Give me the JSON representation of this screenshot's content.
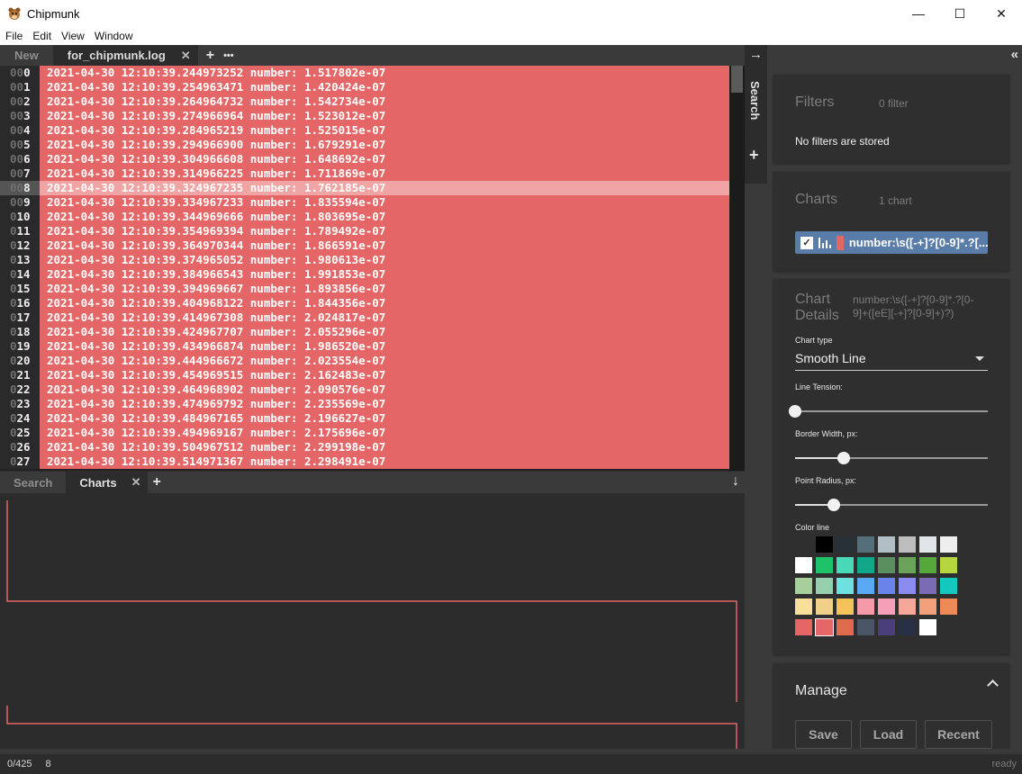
{
  "window": {
    "title": "Chipmunk",
    "minimize": "—",
    "maximize": "☐",
    "close": "✕"
  },
  "menu": [
    "File",
    "Edit",
    "View",
    "Window"
  ],
  "tabs": {
    "new_label": "New",
    "file_label": "for_chipmunk.log",
    "close": "✕",
    "add": "+",
    "more": "•••"
  },
  "log": {
    "rows": [
      {
        "n": "0",
        "pad": "00",
        "text": "2021-04-30 12:10:39.244973252 number: 1.517802e-07"
      },
      {
        "n": "1",
        "pad": "00",
        "text": "2021-04-30 12:10:39.254963471 number: 1.420424e-07"
      },
      {
        "n": "2",
        "pad": "00",
        "text": "2021-04-30 12:10:39.264964732 number: 1.542734e-07"
      },
      {
        "n": "3",
        "pad": "00",
        "text": "2021-04-30 12:10:39.274966964 number: 1.523012e-07"
      },
      {
        "n": "4",
        "pad": "00",
        "text": "2021-04-30 12:10:39.284965219 number: 1.525015e-07"
      },
      {
        "n": "5",
        "pad": "00",
        "text": "2021-04-30 12:10:39.294966900 number: 1.679291e-07"
      },
      {
        "n": "6",
        "pad": "00",
        "text": "2021-04-30 12:10:39.304966608 number: 1.648692e-07"
      },
      {
        "n": "7",
        "pad": "00",
        "text": "2021-04-30 12:10:39.314966225 number: 1.711869e-07"
      },
      {
        "n": "8",
        "pad": "00",
        "text": "2021-04-30 12:10:39.324967235 number: 1.762185e-07"
      },
      {
        "n": "9",
        "pad": "00",
        "text": "2021-04-30 12:10:39.334967233 number: 1.835594e-07"
      },
      {
        "n": "10",
        "pad": "0",
        "text": "2021-04-30 12:10:39.344969666 number: 1.803695e-07"
      },
      {
        "n": "11",
        "pad": "0",
        "text": "2021-04-30 12:10:39.354969394 number: 1.789492e-07"
      },
      {
        "n": "12",
        "pad": "0",
        "text": "2021-04-30 12:10:39.364970344 number: 1.866591e-07"
      },
      {
        "n": "13",
        "pad": "0",
        "text": "2021-04-30 12:10:39.374965052 number: 1.980613e-07"
      },
      {
        "n": "14",
        "pad": "0",
        "text": "2021-04-30 12:10:39.384966543 number: 1.991853e-07"
      },
      {
        "n": "15",
        "pad": "0",
        "text": "2021-04-30 12:10:39.394969667 number: 1.893856e-07"
      },
      {
        "n": "16",
        "pad": "0",
        "text": "2021-04-30 12:10:39.404968122 number: 1.844356e-07"
      },
      {
        "n": "17",
        "pad": "0",
        "text": "2021-04-30 12:10:39.414967308 number: 2.024817e-07"
      },
      {
        "n": "18",
        "pad": "0",
        "text": "2021-04-30 12:10:39.424967707 number: 2.055296e-07"
      },
      {
        "n": "19",
        "pad": "0",
        "text": "2021-04-30 12:10:39.434966874 number: 1.986520e-07"
      },
      {
        "n": "20",
        "pad": "0",
        "text": "2021-04-30 12:10:39.444966672 number: 2.023554e-07"
      },
      {
        "n": "21",
        "pad": "0",
        "text": "2021-04-30 12:10:39.454969515 number: 2.162483e-07"
      },
      {
        "n": "22",
        "pad": "0",
        "text": "2021-04-30 12:10:39.464968902 number: 2.090576e-07"
      },
      {
        "n": "23",
        "pad": "0",
        "text": "2021-04-30 12:10:39.474969792 number: 2.235569e-07"
      },
      {
        "n": "24",
        "pad": "0",
        "text": "2021-04-30 12:10:39.484967165 number: 2.196627e-07"
      },
      {
        "n": "25",
        "pad": "0",
        "text": "2021-04-30 12:10:39.494969167 number: 2.175696e-07"
      },
      {
        "n": "26",
        "pad": "0",
        "text": "2021-04-30 12:10:39.504967512 number: 2.299198e-07"
      },
      {
        "n": "27",
        "pad": "0",
        "text": "2021-04-30 12:10:39.514971367 number: 2.298491e-07"
      }
    ],
    "selected_row": 8,
    "match_color": "#e56666"
  },
  "bottom_tabs": {
    "search_label": "Search",
    "charts_label": "Charts",
    "close": "✕",
    "add": "+",
    "down": "↓"
  },
  "side": {
    "search_tab": "Search",
    "arrow": "→",
    "add": "+"
  },
  "filters": {
    "title": "Filters",
    "count": "0 filter",
    "empty_text": "No filters are stored"
  },
  "charts": {
    "title": "Charts",
    "count": "1 chart",
    "entry_label": "number:\\s([-+]?[0-9]*.?[...",
    "entry_color": "#e56666"
  },
  "chart_details": {
    "title_line1": "Chart",
    "title_line2": "Details",
    "regex_line1": "number:\\s([-+]?[0-9]*.?[0-",
    "regex_line2": "9]+([eE][-+]?[0-9]+)?)",
    "chart_type_label": "Chart type",
    "chart_type_value": "Smooth Line",
    "line_tension_label": "Line Tension:",
    "line_tension": 0,
    "border_width_label": "Border Width, px:",
    "border_width_fraction": 0.25,
    "point_radius_label": "Point Radius, px:",
    "point_radius_fraction": 0.2,
    "color_line_label": "Color line",
    "palette": [
      [
        "#2f2f2f",
        "#000000",
        "#263238",
        "#546e7a",
        "#b0bec5",
        "#bdbdbd",
        "#e0e6e8",
        "#eeeeee"
      ],
      [
        "#ffffff",
        "#1ec26b",
        "#4ad9b8",
        "#10a888",
        "#5a8f5f",
        "#6ba35a",
        "#56a83b",
        "#b5d63e"
      ],
      [
        "#a7cf9b",
        "#95cfae",
        "#6fe0e0",
        "#5aa9f5",
        "#6a83ea",
        "#8b8bf0",
        "#7a6bb5",
        "#14c8c0"
      ],
      [
        "#f8e09a",
        "#f2cf8a",
        "#f5c35a",
        "#f59aa8",
        "#f5a0b8",
        "#f5a89a",
        "#f2a07a",
        "#ee8a55"
      ],
      [
        "#e56666",
        "#e56666",
        "#e06a4e",
        "#4a5566",
        "#4a3f7a",
        "#283046",
        "#ffffff",
        null
      ]
    ]
  },
  "manage": {
    "title": "Manage",
    "save": "Save",
    "load": "Load",
    "recent": "Recent"
  },
  "status": {
    "left_count": "0/425",
    "left_pos": "8",
    "right": "ready"
  }
}
